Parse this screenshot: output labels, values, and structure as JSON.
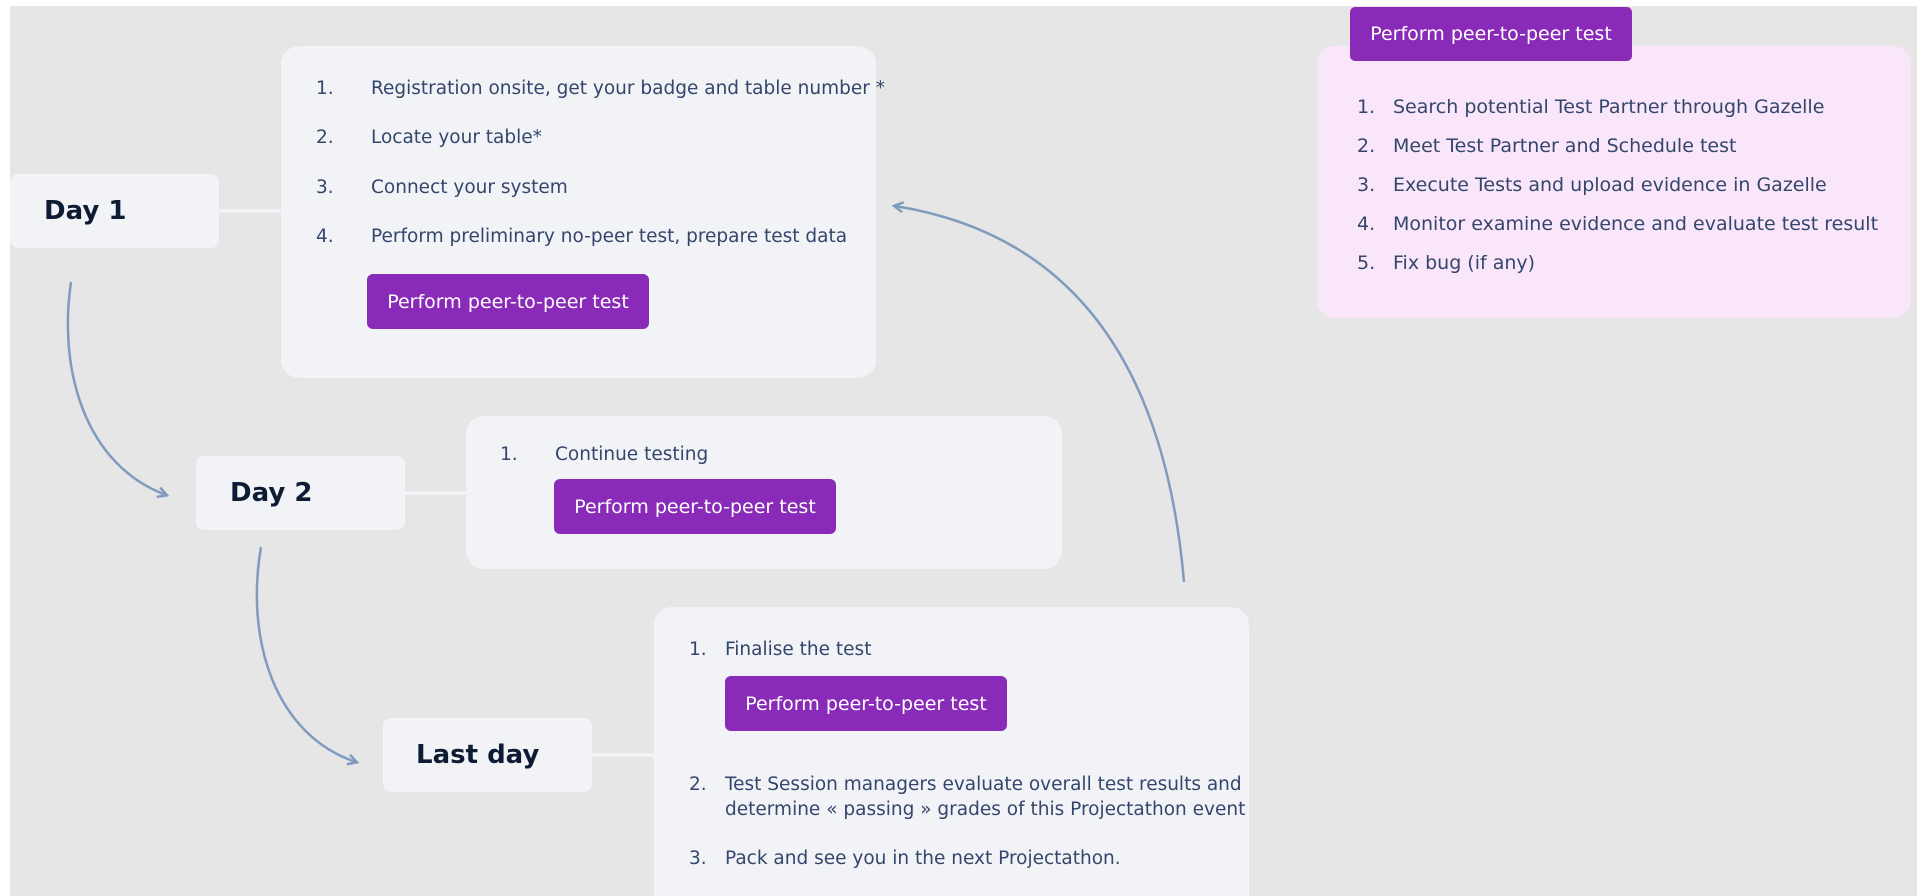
{
  "days": [
    {
      "label": "Day 1"
    },
    {
      "label": "Day 2"
    },
    {
      "label": "Last day"
    }
  ],
  "cards": {
    "day1": {
      "items": [
        {
          "num": "1.",
          "text": "Registration onsite, get your badge and table number *"
        },
        {
          "num": "2.",
          "text": "Locate your table*"
        },
        {
          "num": "3.",
          "text": "Connect your system"
        },
        {
          "num": "4.",
          "text": "Perform preliminary no-peer test, prepare test data"
        }
      ],
      "button_label": "Perform peer-to-peer test"
    },
    "day2": {
      "items": [
        {
          "num": "1.",
          "text": "Continue testing"
        }
      ],
      "button_label": "Perform peer-to-peer test"
    },
    "last": {
      "items": [
        {
          "num": "1.",
          "text": "Finalise the test"
        },
        {
          "num": "2.",
          "text": "Test Session managers evaluate overall test results and",
          "text2": "determine « passing » grades of this Projectathon event"
        },
        {
          "num": "3.",
          "text": "Pack and see you in the next Projectathon."
        }
      ],
      "button_label": "Perform peer-to-peer test"
    }
  },
  "peer_test_panel": {
    "title": "Perform peer-to-peer test",
    "steps": [
      {
        "num": "1.",
        "text": "Search potential Test Partner through Gazelle"
      },
      {
        "num": "2.",
        "text": "Meet Test Partner and Schedule test"
      },
      {
        "num": "3.",
        "text": "Execute Tests and upload evidence in Gazelle"
      },
      {
        "num": "4.",
        "text": "Monitor examine evidence and evaluate test result"
      },
      {
        "num": "5.",
        "text": "Fix bug (if any)"
      }
    ]
  },
  "colors": {
    "background": "#e6e6e6",
    "card": "#f1f3f7",
    "button": "#8a2ab8",
    "panel": "#f9e6fa",
    "arrow": "#7f9bbd"
  }
}
